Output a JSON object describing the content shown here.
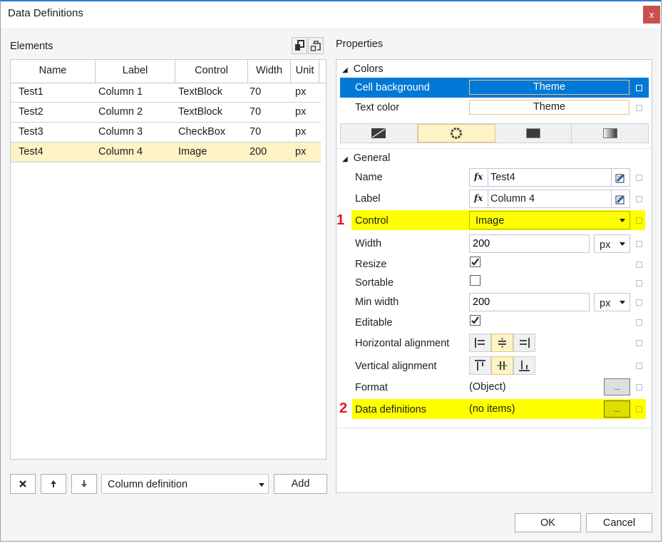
{
  "window": {
    "title": "Data Definitions",
    "close_label": "x"
  },
  "elements_panel": {
    "label": "Elements",
    "toolbar_icons": [
      "copy-icon",
      "paste-icon"
    ],
    "columns": [
      "Name",
      "Label",
      "Control",
      "Width",
      "Unit"
    ],
    "rows": [
      {
        "name": "Test1",
        "label": "Column 1",
        "control": "TextBlock",
        "width": "70",
        "unit": "px"
      },
      {
        "name": "Test2",
        "label": "Column 2",
        "control": "TextBlock",
        "width": "70",
        "unit": "px"
      },
      {
        "name": "Test3",
        "label": "Column 3",
        "control": "CheckBox",
        "width": "70",
        "unit": "px"
      },
      {
        "name": "Test4",
        "label": "Column 4",
        "control": "Image",
        "width": "200",
        "unit": "px",
        "selected": true
      }
    ],
    "bottom_bar": {
      "delete_icon": "close-icon",
      "up_icon": "arrow-up-icon",
      "down_icon": "arrow-down-icon",
      "type_select": "Column definition",
      "add_label": "Add"
    }
  },
  "properties_panel": {
    "label": "Properties",
    "colors": {
      "header": "Colors",
      "cell_background": {
        "label": "Cell background",
        "value": "Theme"
      },
      "text_color": {
        "label": "Text color",
        "value": "Theme"
      },
      "fill_modes": [
        "no-fill-icon",
        "theme-fill-icon",
        "solid-fill-icon",
        "gradient-fill-icon"
      ],
      "fill_mode_selected": 1
    },
    "general": {
      "header": "General",
      "name": {
        "label": "Name",
        "value": "Test4"
      },
      "label": {
        "label": "Label",
        "value": "Column 4"
      },
      "control": {
        "label": "Control",
        "value": "Image",
        "marker": "1"
      },
      "width": {
        "label": "Width",
        "value": "200",
        "unit": "px"
      },
      "resize": {
        "label": "Resize",
        "checked": true
      },
      "sortable": {
        "label": "Sortable",
        "checked": false
      },
      "min_width": {
        "label": "Min width",
        "value": "200",
        "unit": "px"
      },
      "editable": {
        "label": "Editable",
        "checked": true
      },
      "horizontal_alignment": {
        "label": "Horizontal alignment",
        "options": [
          "left",
          "center",
          "right"
        ],
        "selected": 1
      },
      "vertical_alignment": {
        "label": "Vertical alignment",
        "options": [
          "top",
          "center",
          "bottom"
        ],
        "selected": 1
      },
      "format": {
        "label": "Format",
        "value": "(Object)",
        "button": "..."
      },
      "data_definitions": {
        "label": "Data definitions",
        "value": "(no items)",
        "button": "...",
        "marker": "2"
      }
    }
  },
  "footer": {
    "ok_label": "OK",
    "cancel_label": "Cancel"
  },
  "colors": {
    "accent": "#0078d7",
    "selection": "#fdf3c5",
    "highlight": "#ffff00",
    "marker": "#e81123",
    "close": "#cb5051"
  }
}
